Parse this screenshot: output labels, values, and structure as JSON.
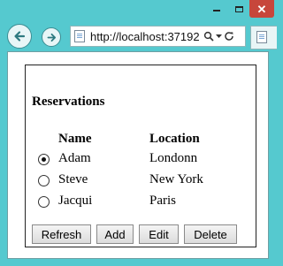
{
  "browser": {
    "url": "http://localhost:37192",
    "window_buttons": {
      "minimize": "minimize-icon",
      "maximize": "maximize-icon",
      "close": "✕"
    }
  },
  "page": {
    "heading": "Reservations",
    "columns": [
      "Name",
      "Location"
    ],
    "rows": [
      {
        "name": "Adam",
        "location": "Londonn",
        "selected": true
      },
      {
        "name": "Steve",
        "location": "New York",
        "selected": false
      },
      {
        "name": "Jacqui",
        "location": "Paris",
        "selected": false
      }
    ],
    "buttons": {
      "refresh": "Refresh",
      "add": "Add",
      "edit": "Edit",
      "delete": "Delete"
    }
  }
}
